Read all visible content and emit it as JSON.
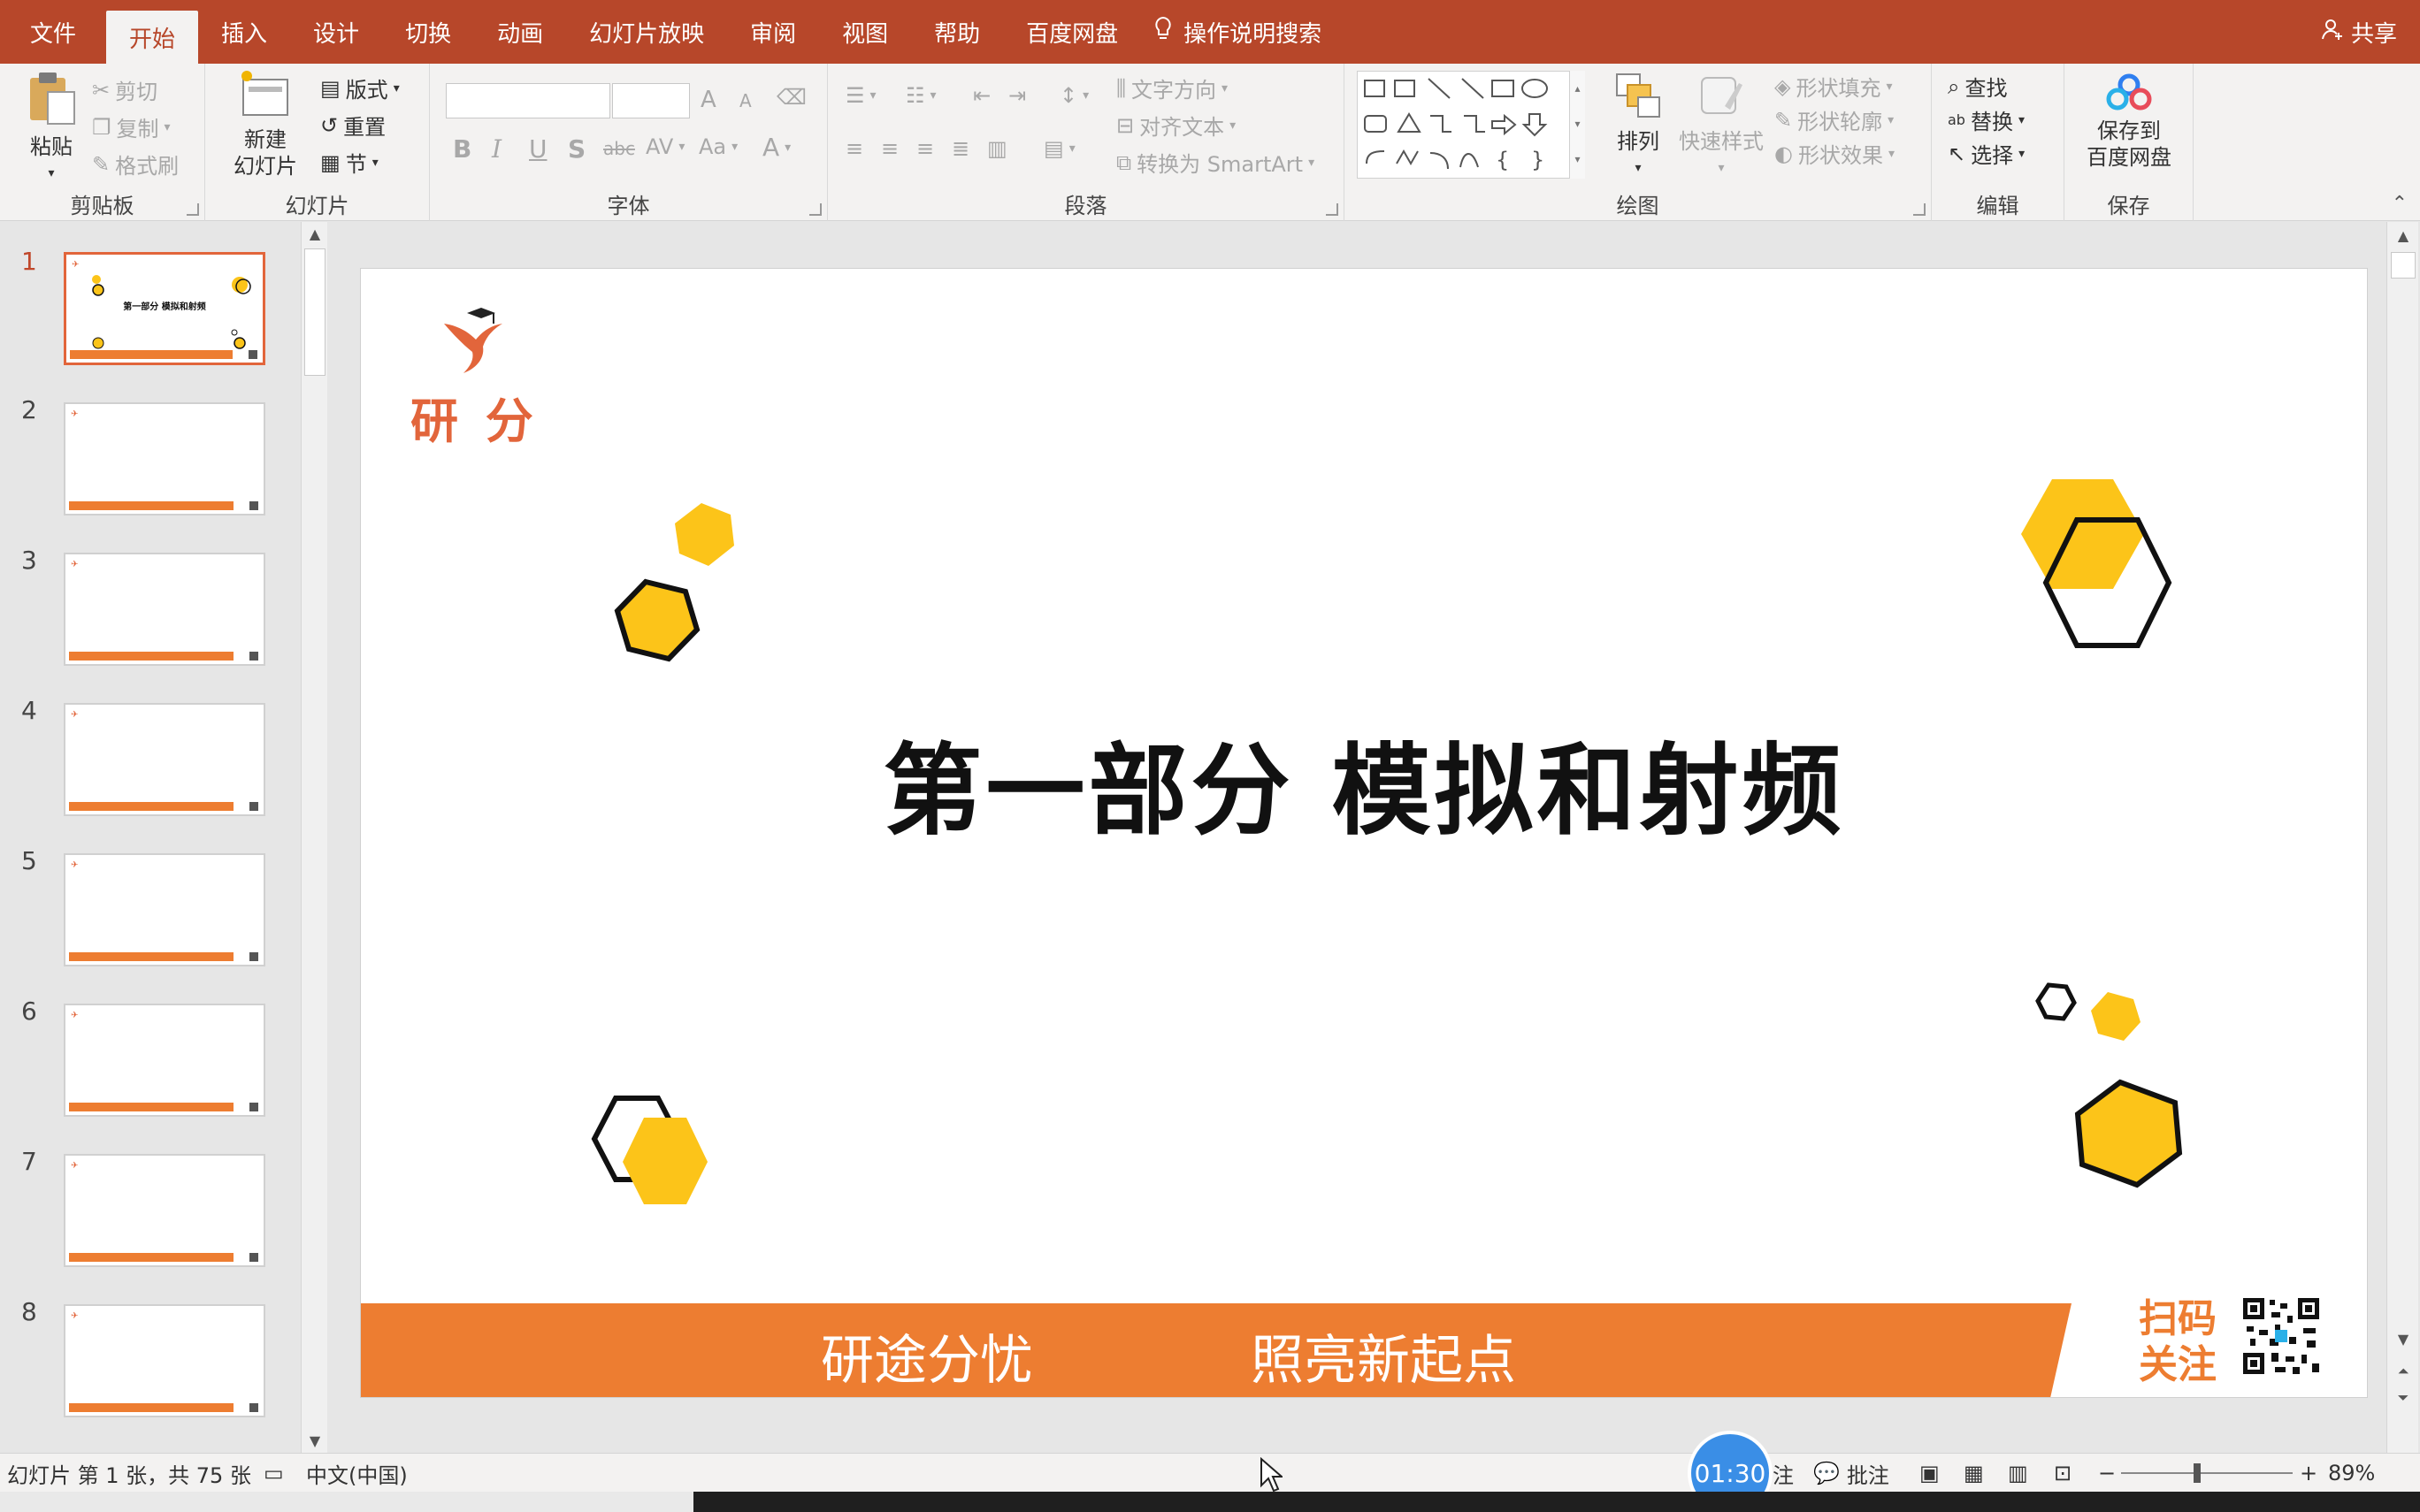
{
  "menu": {
    "tabs": [
      "文件",
      "开始",
      "插入",
      "设计",
      "切换",
      "动画",
      "幻灯片放映",
      "审阅",
      "视图",
      "帮助",
      "百度网盘"
    ],
    "active_tab": "开始",
    "tell_me": "操作说明搜索",
    "share": "共享"
  },
  "ribbon": {
    "clipboard": {
      "label": "剪贴板",
      "paste": "粘贴",
      "cut": "剪切",
      "copy": "复制",
      "format_painter": "格式刷"
    },
    "slides": {
      "label": "幻灯片",
      "new_slide_line1": "新建",
      "new_slide_line2": "幻灯片",
      "layout": "版式",
      "reset": "重置",
      "section": "节"
    },
    "font": {
      "label": "字体",
      "bold": "B",
      "italic": "I",
      "underline": "U",
      "shadow": "S",
      "strike": "abc",
      "spacing": "AV",
      "case": "Aa",
      "color": "A",
      "grow": "A",
      "shrink": "A"
    },
    "paragraph": {
      "label": "段落",
      "text_direction": "文字方向",
      "align_text": "对齐文本",
      "smartart": "转换为 SmartArt"
    },
    "drawing": {
      "label": "绘图",
      "arrange": "排列",
      "quick_styles": "快速样式",
      "shape_fill": "形状填充",
      "shape_outline": "形状轮廓",
      "shape_effects": "形状效果"
    },
    "editing": {
      "label": "编辑",
      "find": "查找",
      "replace": "替换",
      "select": "选择"
    },
    "save": {
      "label": "保存",
      "save_line1": "保存到",
      "save_line2": "百度网盘"
    }
  },
  "thumbnails": {
    "numbers": [
      "1",
      "2",
      "3",
      "4",
      "5",
      "6",
      "7",
      "8"
    ],
    "selected": "1",
    "first_title": "第一部分 模拟和射频"
  },
  "slide": {
    "logo_text": "研 分",
    "title": "第一部分 模拟和射频",
    "slogan_left": "研途分忧",
    "slogan_right": "照亮新起点",
    "scan_line1": "扫码",
    "scan_line2": "关注",
    "colors": {
      "accent": "#ed7d31",
      "hex_fill": "#fcc419",
      "hex_stroke": "#111111",
      "logo": "#e2653b"
    }
  },
  "status": {
    "slide_info": "幻灯片 第 1 张，共 75 张",
    "language": "中文(中国)",
    "notes": "注",
    "comments": "批注",
    "zoom": "89%",
    "timer": "01:30"
  }
}
